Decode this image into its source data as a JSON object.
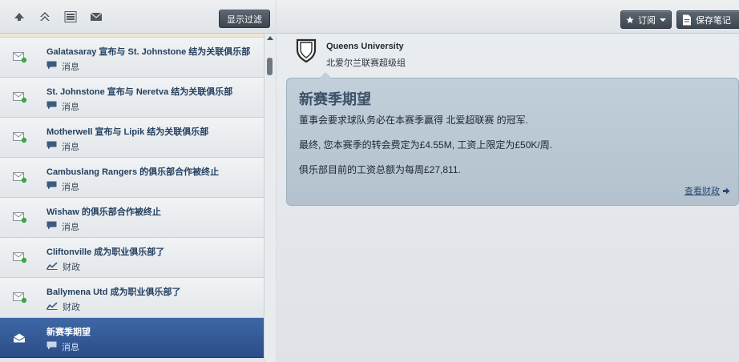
{
  "left_toolbar": {
    "icons": [
      "arrow-up-icon",
      "double-chevron-up-icon",
      "list-icon",
      "mail-icon"
    ],
    "filter_button": "显示过滤"
  },
  "inbox": {
    "items": [
      {
        "title": "Galatasaray 宣布与 St. Johnstone 结为关联俱乐部",
        "category": "消息",
        "category_icon": "speech-bubble-icon"
      },
      {
        "title": "St. Johnstone 宣布与 Neretva 结为关联俱乐部",
        "category": "消息",
        "category_icon": "speech-bubble-icon"
      },
      {
        "title": "Motherwell 宣布与 Lipik 结为关联俱乐部",
        "category": "消息",
        "category_icon": "speech-bubble-icon"
      },
      {
        "title": "Cambuslang Rangers 的俱乐部合作被终止",
        "category": "消息",
        "category_icon": "speech-bubble-icon"
      },
      {
        "title": "Wishaw 的俱乐部合作被终止",
        "category": "消息",
        "category_icon": "speech-bubble-icon"
      },
      {
        "title": "Cliftonville 成为职业俱乐部了",
        "category": "财政",
        "category_icon": "finance-chart-icon"
      },
      {
        "title": "Ballymena Utd 成为职业俱乐部了",
        "category": "财政",
        "category_icon": "finance-chart-icon"
      },
      {
        "title": "新赛季期望",
        "category": "消息",
        "category_icon": "speech-bubble-icon",
        "selected": true
      }
    ]
  },
  "right_toolbar": {
    "subscribe_label": "订阅",
    "save_note_label": "保存笔记"
  },
  "message": {
    "club_name": "Queens University",
    "league_name": "北爱尔兰联赛超级组",
    "title": "新赛季期望",
    "line1": "董事会要求球队务必在本赛季赢得 北爱超联赛 的冠军.",
    "line2": "最终, 您本赛季的转会费定为£4.55M, 工资上限定为£50K/周.",
    "line3": "俱乐部目前的工资总额为每周£27,811.",
    "link": "查看财政"
  },
  "colors": {
    "accent": "#2a4d88",
    "card": "#b8c6d2",
    "unread_dot": "#3aa845"
  }
}
